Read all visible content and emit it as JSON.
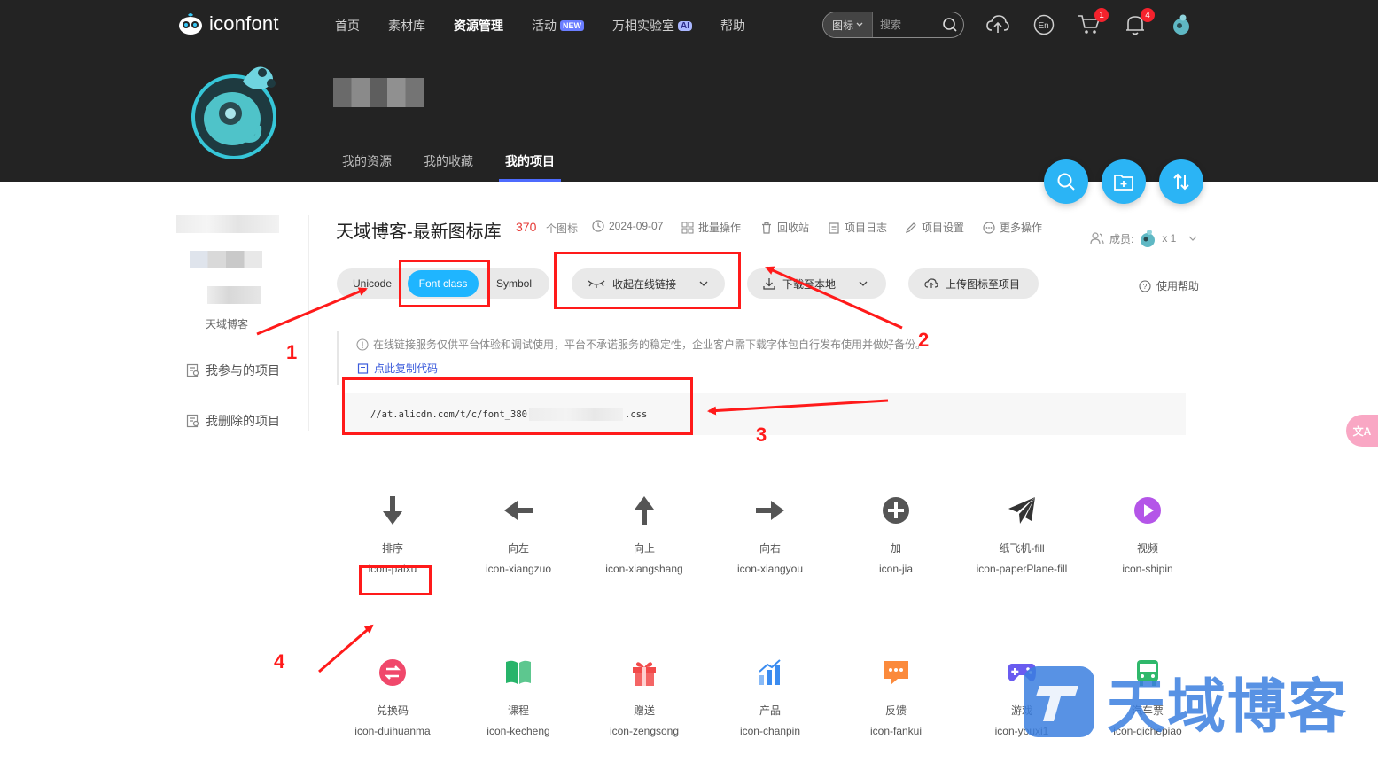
{
  "header": {
    "logo_text": "iconfont",
    "nav": [
      {
        "label": "首页"
      },
      {
        "label": "素材库"
      },
      {
        "label": "资源管理"
      },
      {
        "label": "活动",
        "badge": "NEW"
      },
      {
        "label": "万相实验室",
        "badge": "AI"
      },
      {
        "label": "帮助"
      }
    ],
    "search": {
      "type_label": "图标",
      "placeholder": "搜索"
    },
    "cart_badge": "1",
    "bell_badge": "4",
    "subnav": [
      {
        "label": "我的资源"
      },
      {
        "label": "我的收藏"
      },
      {
        "label": "我的项目"
      }
    ]
  },
  "sidebar": {
    "username": "天域博客",
    "links": [
      {
        "label": "我参与的项目"
      },
      {
        "label": "我删除的项目"
      }
    ]
  },
  "project": {
    "title": "天域博客-最新图标库",
    "count": "370",
    "count_unit": "个图标",
    "meta": [
      {
        "label": "2024-09-07"
      },
      {
        "label": "批量操作"
      },
      {
        "label": "回收站"
      },
      {
        "label": "项目日志"
      },
      {
        "label": "项目设置"
      },
      {
        "label": "更多操作"
      }
    ],
    "members_label": "成员:",
    "members_count": "x 1"
  },
  "toolbar": {
    "tabs": [
      {
        "label": "Unicode"
      },
      {
        "label": "Font class"
      },
      {
        "label": "Symbol"
      }
    ],
    "online_link": "收起在线链接",
    "download": "下载至本地",
    "upload": "上传图标至项目",
    "help": "使用帮助"
  },
  "notice": "在线链接服务仅供平台体验和调试使用，平台不承诺服务的稳定性，企业客户需下载字体包自行发布使用并做好备份。",
  "copy_code": "点此复制代码",
  "code_link": {
    "prefix": "//at.alicdn.com/t/c/font_380",
    "suffix": ".css"
  },
  "icons": [
    {
      "name": "排序",
      "class": "icon-paixu",
      "glyph": "arrow-down-icon",
      "color": "#555555"
    },
    {
      "name": "向左",
      "class": "icon-xiangzuo",
      "glyph": "arrow-left-icon",
      "color": "#555555"
    },
    {
      "name": "向上",
      "class": "icon-xiangshang",
      "glyph": "arrow-up-icon",
      "color": "#555555"
    },
    {
      "name": "向右",
      "class": "icon-xiangyou",
      "glyph": "arrow-right-icon",
      "color": "#555555"
    },
    {
      "name": "加",
      "class": "icon-jia",
      "glyph": "plus-circle-icon",
      "color": "#555555"
    },
    {
      "name": "纸飞机-fill",
      "class": "icon-paperPlane-fill",
      "glyph": "paper-plane-icon",
      "color": "#333333"
    },
    {
      "name": "视频",
      "class": "icon-shipin",
      "glyph": "video-play-icon",
      "color": "#b455e8"
    },
    {
      "name": "兑换码",
      "class": "icon-duihuanma",
      "glyph": "exchange-icon",
      "color": "#f0486b"
    },
    {
      "name": "课程",
      "class": "icon-kecheng",
      "glyph": "book-icon",
      "color": "#27b46a"
    },
    {
      "name": "赠送",
      "class": "icon-zengsong",
      "glyph": "gift-icon",
      "color": "#f24a4a"
    },
    {
      "name": "产品",
      "class": "icon-chanpin",
      "glyph": "bar-chart-icon",
      "color": "#3b8cf0"
    },
    {
      "name": "反馈",
      "class": "icon-fankui",
      "glyph": "feedback-icon",
      "color": "#fb8a3c"
    },
    {
      "name": "游戏",
      "class": "icon-youxi1",
      "glyph": "gamepad-icon",
      "color": "#6a5cf0"
    },
    {
      "name": "汽车票",
      "class": "icon-qichepiao",
      "glyph": "bus-icon",
      "color": "#2fb86b"
    }
  ],
  "annotations": [
    "1",
    "2",
    "3",
    "4"
  ],
  "translate_tab": "文A",
  "watermark": "天域博客"
}
